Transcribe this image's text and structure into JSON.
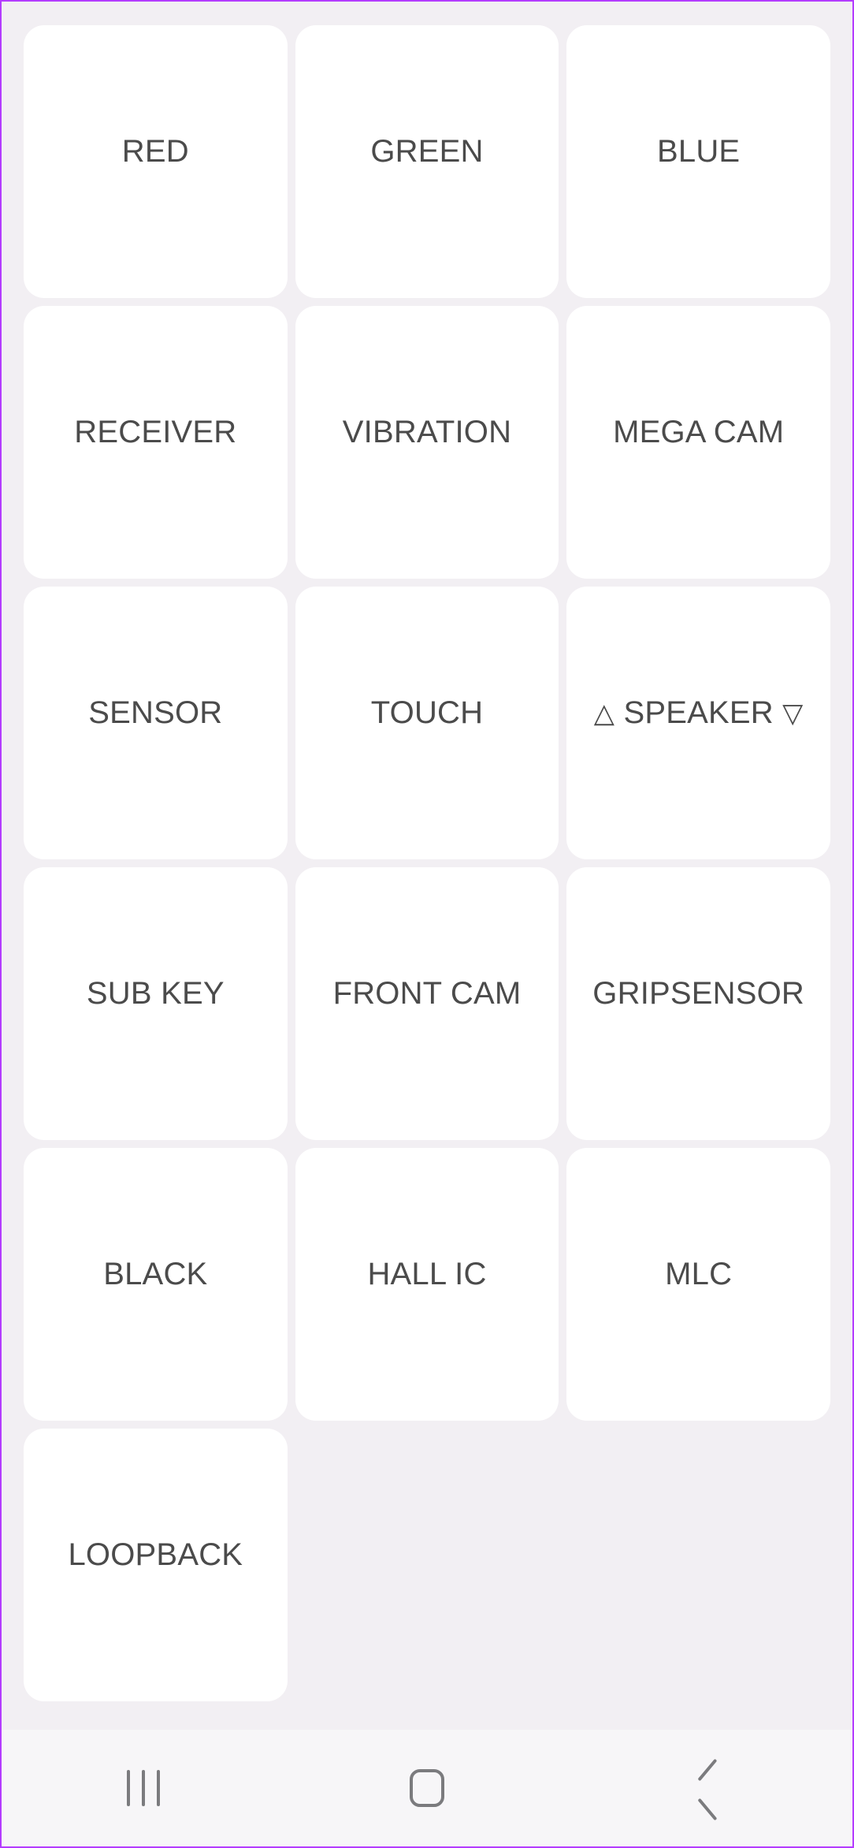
{
  "theme": {
    "screenshot_border_color": "#b43cff",
    "page_background": "#f2eff3",
    "tile_background": "#ffffff",
    "tile_label_color": "#4b4b4b",
    "navbar_background": "#f7f6f8",
    "navbar_icon_color": "#7b7b7e"
  },
  "grid": {
    "columns": 3,
    "tiles": [
      {
        "label": "RED"
      },
      {
        "label": "GREEN"
      },
      {
        "label": "BLUE"
      },
      {
        "label": "RECEIVER"
      },
      {
        "label": "VIBRATION"
      },
      {
        "label": "MEGA CAM"
      },
      {
        "label": "SENSOR"
      },
      {
        "label": "TOUCH"
      },
      {
        "label": "△ SPEAKER ▽"
      },
      {
        "label": "SUB KEY"
      },
      {
        "label": "FRONT CAM"
      },
      {
        "label": "GRIPSENSOR"
      },
      {
        "label": "BLACK"
      },
      {
        "label": "HALL IC"
      },
      {
        "label": "MLC"
      },
      {
        "label": "LOOPBACK"
      }
    ]
  },
  "navbar": {
    "buttons": [
      {
        "name": "recents",
        "icon": "recents-icon"
      },
      {
        "name": "home",
        "icon": "home-icon"
      },
      {
        "name": "back",
        "icon": "back-icon"
      }
    ]
  }
}
